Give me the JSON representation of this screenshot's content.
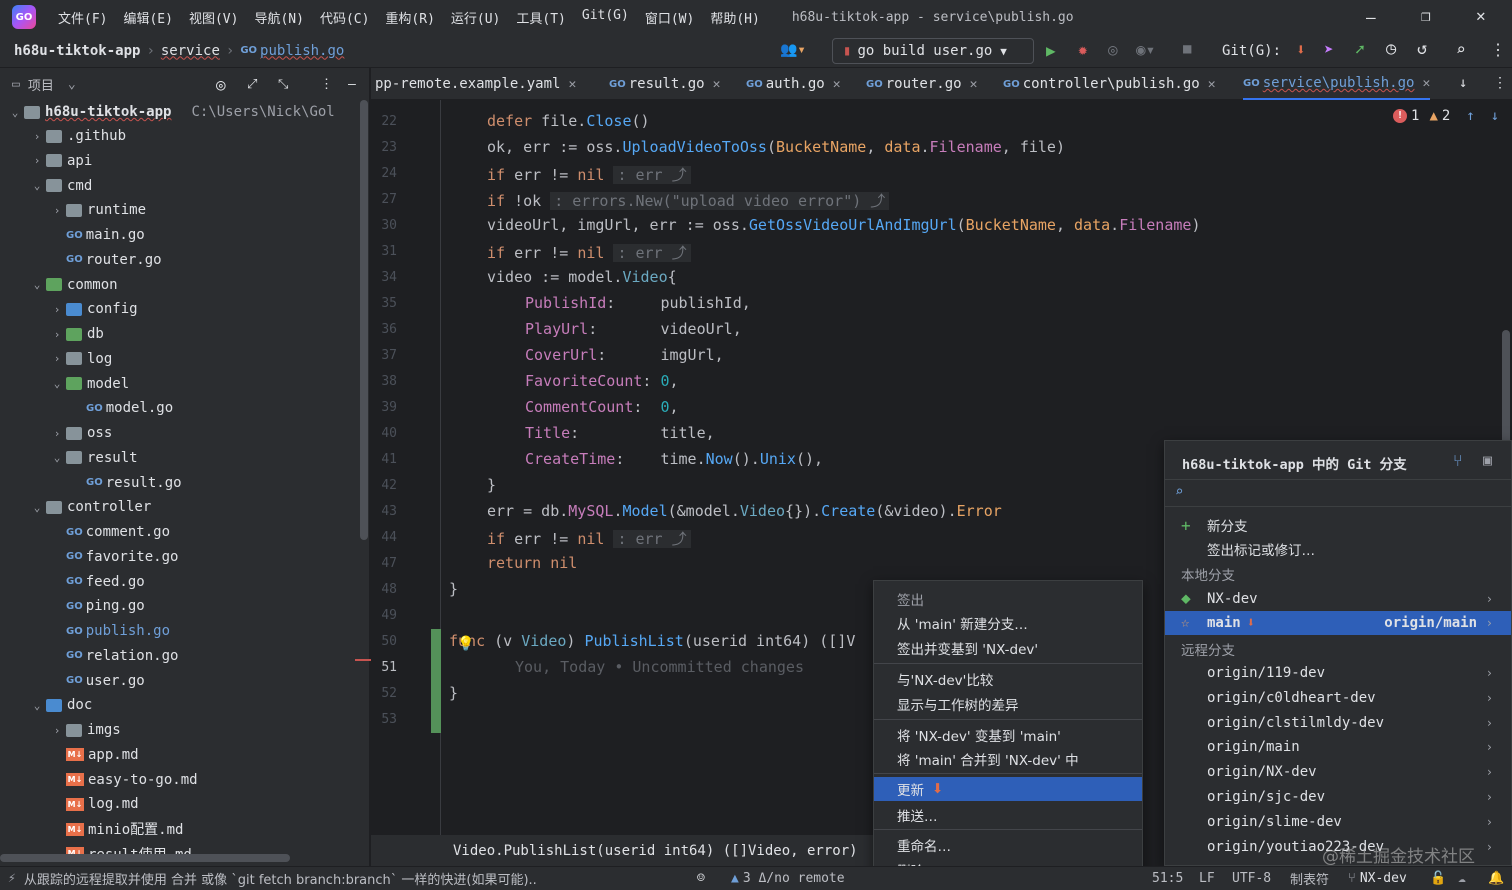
{
  "titlebar": {
    "menu": [
      "文件(F)",
      "编辑(E)",
      "视图(V)",
      "导航(N)",
      "代码(C)",
      "重构(R)",
      "运行(U)",
      "工具(T)",
      "Git(G)",
      "窗口(W)",
      "帮助(H)"
    ],
    "title": "h68u-tiktok-app - service\\publish.go"
  },
  "navbar": {
    "crumb_project": "h68u-tiktok-app",
    "crumb_dir": "service",
    "crumb_file": "publish.go",
    "run_config": "go build user.go",
    "git_label": "Git(G):"
  },
  "project": {
    "title": "项目",
    "root_name": "h68u-tiktok-app",
    "root_path": "C:\\Users\\Nick\\Gol",
    "items": [
      {
        "label": ".github",
        "depth": 1,
        "arrow": ">",
        "icon": "folder"
      },
      {
        "label": "api",
        "depth": 1,
        "arrow": ">",
        "icon": "folder"
      },
      {
        "label": "cmd",
        "depth": 1,
        "arrow": "v",
        "icon": "folder"
      },
      {
        "label": "runtime",
        "depth": 2,
        "arrow": ">",
        "icon": "folder"
      },
      {
        "label": "main.go",
        "depth": 2,
        "arrow": "",
        "icon": "go"
      },
      {
        "label": "router.go",
        "depth": 2,
        "arrow": "",
        "icon": "go"
      },
      {
        "label": "common",
        "depth": 1,
        "arrow": "v",
        "icon": "folder-green"
      },
      {
        "label": "config",
        "depth": 2,
        "arrow": ">",
        "icon": "folder-blue"
      },
      {
        "label": "db",
        "depth": 2,
        "arrow": ">",
        "icon": "folder-green"
      },
      {
        "label": "log",
        "depth": 2,
        "arrow": ">",
        "icon": "folder"
      },
      {
        "label": "model",
        "depth": 2,
        "arrow": "v",
        "icon": "folder-green"
      },
      {
        "label": "model.go",
        "depth": 3,
        "arrow": "",
        "icon": "go"
      },
      {
        "label": "oss",
        "depth": 2,
        "arrow": ">",
        "icon": "folder"
      },
      {
        "label": "result",
        "depth": 2,
        "arrow": "v",
        "icon": "folder"
      },
      {
        "label": "result.go",
        "depth": 3,
        "arrow": "",
        "icon": "go"
      },
      {
        "label": "controller",
        "depth": 1,
        "arrow": "v",
        "icon": "folder"
      },
      {
        "label": "comment.go",
        "depth": 2,
        "arrow": "",
        "icon": "go"
      },
      {
        "label": "favorite.go",
        "depth": 2,
        "arrow": "",
        "icon": "go"
      },
      {
        "label": "feed.go",
        "depth": 2,
        "arrow": "",
        "icon": "go"
      },
      {
        "label": "ping.go",
        "depth": 2,
        "arrow": "",
        "icon": "go"
      },
      {
        "label": "publish.go",
        "depth": 2,
        "arrow": "",
        "icon": "go"
      },
      {
        "label": "relation.go",
        "depth": 2,
        "arrow": "",
        "icon": "go"
      },
      {
        "label": "user.go",
        "depth": 2,
        "arrow": "",
        "icon": "go"
      },
      {
        "label": "doc",
        "depth": 1,
        "arrow": "v",
        "icon": "folder-blue"
      },
      {
        "label": "imgs",
        "depth": 2,
        "arrow": ">",
        "icon": "folder"
      },
      {
        "label": "app.md",
        "depth": 2,
        "arrow": "",
        "icon": "md"
      },
      {
        "label": "easy-to-go.md",
        "depth": 2,
        "arrow": "",
        "icon": "md"
      },
      {
        "label": "log.md",
        "depth": 2,
        "arrow": "",
        "icon": "md"
      },
      {
        "label": "minio配置.md",
        "depth": 2,
        "arrow": "",
        "icon": "md"
      },
      {
        "label": "result使用.md",
        "depth": 2,
        "arrow": "",
        "icon": "md"
      }
    ]
  },
  "tabs": [
    {
      "label": "pp-remote.example.yaml",
      "go": false
    },
    {
      "label": "result.go",
      "go": true
    },
    {
      "label": "auth.go",
      "go": true
    },
    {
      "label": "router.go",
      "go": true
    },
    {
      "label": "controller\\publish.go",
      "go": true
    },
    {
      "label": "service\\publish.go",
      "go": true
    }
  ],
  "editor": {
    "errors": "1",
    "warnings": "2",
    "line_numbers": [
      "22",
      "23",
      "24",
      "27",
      "30",
      "31",
      "34",
      "35",
      "36",
      "37",
      "38",
      "39",
      "40",
      "41",
      "42",
      "43",
      "44",
      "47",
      "48",
      "49",
      "50",
      "51",
      "52",
      "53"
    ],
    "blame": "You, Today • Uncommitted changes",
    "breadcrumb": "Video.PublishList(userid int64) ([]Video, error)"
  },
  "context_menu": {
    "items": [
      "签出",
      "从 'main' 新建分支…",
      "签出并变基到 'NX-dev'",
      "与'NX-dev'比较",
      "显示与工作树的差异",
      "将 'NX-dev' 变基到 'main'",
      "将 'main' 合并到 'NX-dev' 中",
      "更新",
      "推送…",
      "重命名…",
      "删除"
    ]
  },
  "git_popup": {
    "title": "h68u-tiktok-app 中的 Git 分支",
    "new_branch": "新分支",
    "checkout_tag": "签出标记或修订…",
    "local_header": "本地分支",
    "local": [
      {
        "name": "NX-dev",
        "tracking": ""
      },
      {
        "name": "main",
        "tracking": "origin/main"
      }
    ],
    "remote_header": "远程分支",
    "remote": [
      "origin/119-dev",
      "origin/c0ldheart-dev",
      "origin/clstilmldy-dev",
      "origin/main",
      "origin/NX-dev",
      "origin/sjc-dev",
      "origin/slime-dev",
      "origin/youtiao223-dev"
    ]
  },
  "status": {
    "message": "从跟踪的远程提取并使用 合并 或像 `git fetch branch:branch` 一样的快进(如果可能)..",
    "remote": "3 Δ/no remote",
    "position": "51:5",
    "line_sep": "LF",
    "encoding": "UTF-8",
    "indent": "制表符",
    "branch": "NX-dev",
    "watermark": "@稀土掘金技术社区"
  },
  "colors": {
    "accent": "#3574f0",
    "bg": "#1e1f22",
    "panel": "#2b2d30"
  }
}
